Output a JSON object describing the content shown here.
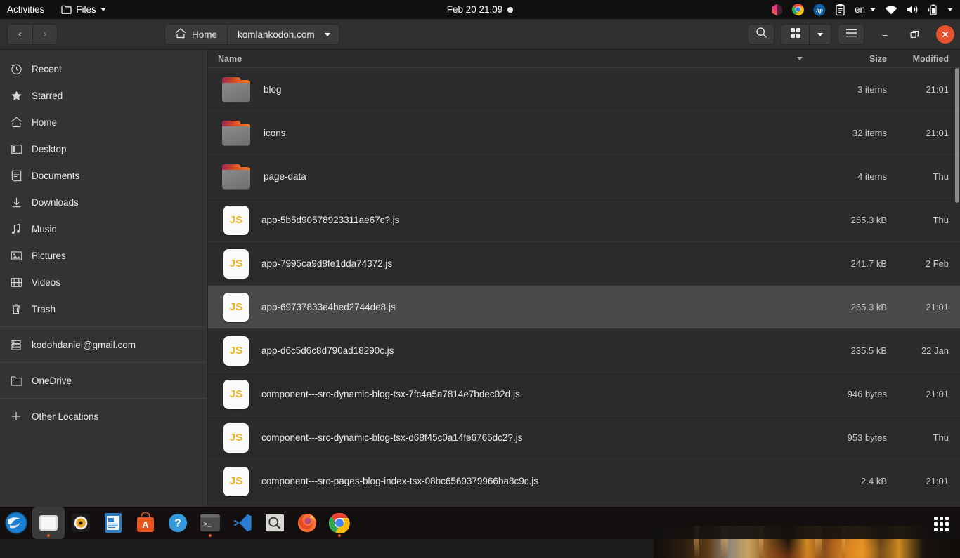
{
  "topbar": {
    "activities": "Activities",
    "app_menu": {
      "label": "Files",
      "icon": "folder-icon",
      "caret": "chevron-down-icon"
    },
    "clock": "Feb 20  21:09",
    "recording_indicator": "recording-dot",
    "indicators": [
      {
        "name": "pinkhex-icon",
        "label": ""
      },
      {
        "name": "chrome-icon",
        "label": ""
      },
      {
        "name": "hp-icon",
        "label": ""
      },
      {
        "name": "clipboard-icon",
        "label": ""
      },
      {
        "name": "keyboard-layout",
        "label": "en"
      },
      {
        "name": "wifi-icon",
        "label": ""
      },
      {
        "name": "volume-icon",
        "label": ""
      },
      {
        "name": "battery-charging-icon",
        "label": ""
      },
      {
        "name": "system-menu-caret-icon",
        "label": ""
      }
    ]
  },
  "headerbar": {
    "back_label": "‹",
    "forward_label": "›",
    "breadcrumbs": [
      {
        "label": "Home",
        "icon": "home-icon"
      },
      {
        "label": "komlankodoh.com",
        "icon": "chevron-down-icon"
      }
    ],
    "search_icon": "search-icon",
    "view_grid_icon": "grid-view-icon",
    "view_caret_icon": "chevron-down-icon",
    "menu_icon": "hamburger-menu-icon",
    "minimize_label": "–",
    "maximize_label": "❐",
    "close_label": "✕",
    "close_color": "#e4512c"
  },
  "sidebar": {
    "groups": [
      {
        "items": [
          {
            "label": "Recent",
            "icon": "clock-icon"
          },
          {
            "label": "Starred",
            "icon": "star-icon"
          },
          {
            "label": "Home",
            "icon": "home-icon"
          },
          {
            "label": "Desktop",
            "icon": "desktop-icon"
          },
          {
            "label": "Documents",
            "icon": "document-icon"
          },
          {
            "label": "Downloads",
            "icon": "download-icon"
          },
          {
            "label": "Music",
            "icon": "music-icon"
          },
          {
            "label": "Pictures",
            "icon": "picture-icon"
          },
          {
            "label": "Videos",
            "icon": "video-icon"
          },
          {
            "label": "Trash",
            "icon": "trash-icon"
          }
        ]
      },
      {
        "items": [
          {
            "label": "kodohdaniel@gmail.com",
            "icon": "server-icon"
          }
        ]
      },
      {
        "items": [
          {
            "label": "OneDrive",
            "icon": "folder-icon"
          }
        ]
      },
      {
        "items": [
          {
            "label": "Other Locations",
            "icon": "plus-icon"
          }
        ]
      }
    ]
  },
  "filelist": {
    "columns": {
      "name": "Name",
      "size": "Size",
      "modified": "Modified"
    },
    "sort_indicator": "sort-descending-caret-icon",
    "rows": [
      {
        "name": "blog",
        "icon": "folder-icon",
        "size": "3 items",
        "modified": "21:01",
        "selected": false
      },
      {
        "name": "icons",
        "icon": "folder-icon",
        "size": "32 items",
        "modified": "21:01",
        "selected": false
      },
      {
        "name": "page-data",
        "icon": "folder-icon",
        "size": "4 items",
        "modified": "Thu",
        "selected": false
      },
      {
        "name": "app-5b5d90578923311ae67c?.js",
        "icon": "js-icon",
        "size": "265.3 kB",
        "modified": "Thu",
        "selected": false
      },
      {
        "name": "app-7995ca9d8fe1dda74372.js",
        "icon": "js-icon",
        "size": "241.7 kB",
        "modified": "2 Feb",
        "selected": false
      },
      {
        "name": "app-69737833e4bed2744de8.js",
        "icon": "js-icon",
        "size": "265.3 kB",
        "modified": "21:01",
        "selected": true
      },
      {
        "name": "app-d6c5d6c8d790ad18290c.js",
        "icon": "js-icon",
        "size": "235.5 kB",
        "modified": "22 Jan",
        "selected": false
      },
      {
        "name": "component---src-dynamic-blog-tsx-7fc4a5a7814e7bdec02d.js",
        "icon": "js-icon",
        "size": "946 bytes",
        "modified": "21:01",
        "selected": false
      },
      {
        "name": "component---src-dynamic-blog-tsx-d68f45c0a14fe6765dc2?.js",
        "icon": "js-icon",
        "size": "953 bytes",
        "modified": "Thu",
        "selected": false
      },
      {
        "name": "component---src-pages-blog-index-tsx-08bc6569379966ba8c9c.js",
        "icon": "js-icon",
        "size": "2.4 kB",
        "modified": "21:01",
        "selected": false
      }
    ],
    "js_icon_label": "JS"
  },
  "dock": {
    "items": [
      {
        "name": "thunderbird-icon",
        "running": false,
        "active": false
      },
      {
        "name": "files-icon",
        "running": true,
        "active": true
      },
      {
        "name": "rhythmbox-icon",
        "running": false,
        "active": false
      },
      {
        "name": "libreoffice-writer-icon",
        "running": false,
        "active": false
      },
      {
        "name": "ubuntu-software-icon",
        "running": false,
        "active": false
      },
      {
        "name": "help-icon",
        "running": false,
        "active": false
      },
      {
        "name": "terminal-icon",
        "running": true,
        "active": false
      },
      {
        "name": "vscode-icon",
        "running": false,
        "active": false
      },
      {
        "name": "magnifier-icon",
        "running": false,
        "active": false
      },
      {
        "name": "firefox-icon",
        "running": false,
        "active": false
      },
      {
        "name": "chrome-icon",
        "running": true,
        "active": false
      }
    ],
    "show_apps": "show-applications-icon"
  },
  "colors": {
    "accent": "#e95420",
    "close": "#e4512c",
    "window_bg": "#2b2b2b",
    "sidebar_bg": "#333333",
    "selected_row": "#4a4a4a",
    "js_yellow": "#f0b323"
  }
}
